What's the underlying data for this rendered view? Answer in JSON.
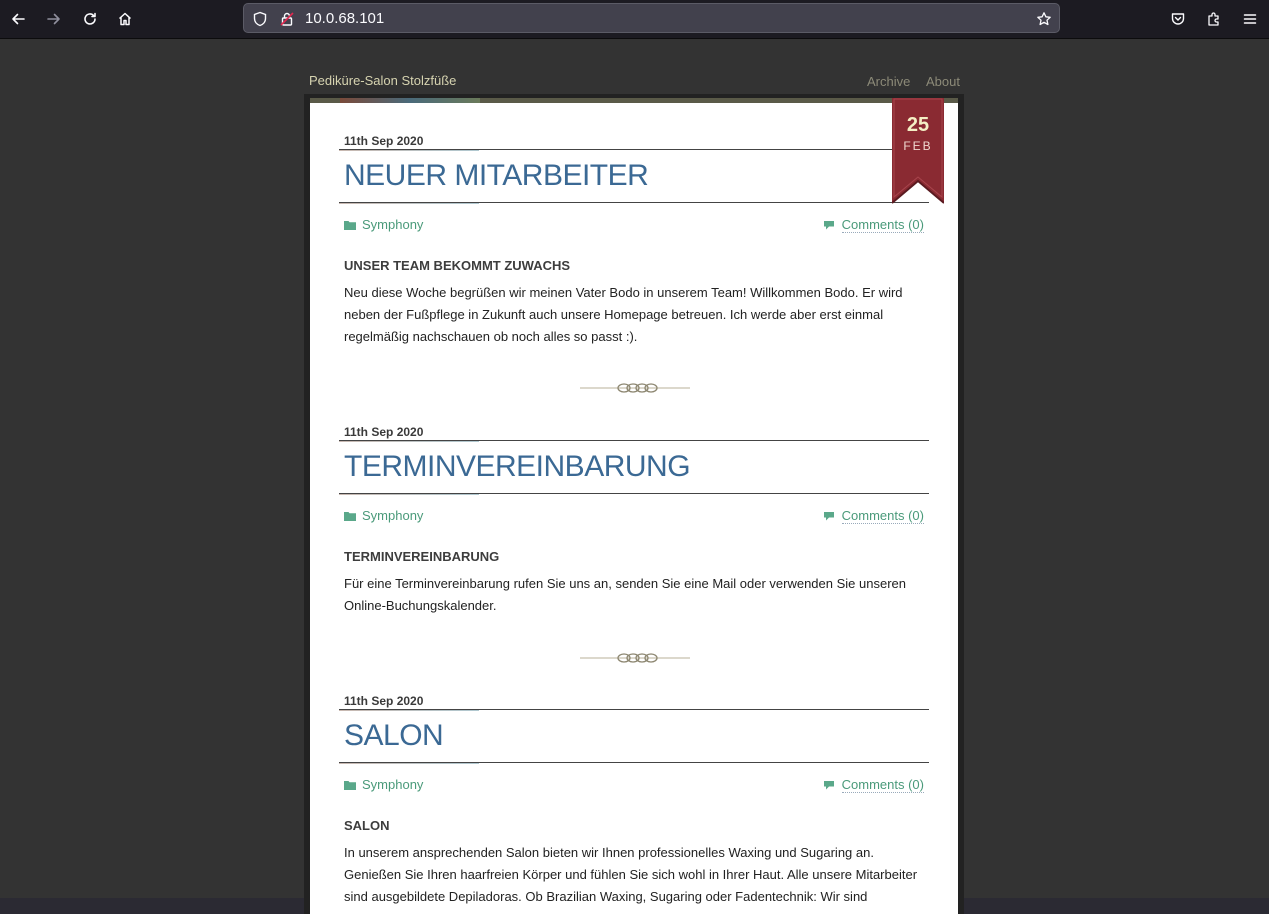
{
  "browser": {
    "url": "10.0.68.101"
  },
  "site": {
    "title": "Pediküre-Salon Stolzfüße",
    "nav": [
      "Archive",
      "About"
    ]
  },
  "ribbon": {
    "day": "25",
    "month": "FEB"
  },
  "posts": [
    {
      "date": "11th Sep 2020",
      "title": "NEUER MITARBEITER",
      "category": "Symphony",
      "comments": "Comments (0)",
      "subhead": "UNSER TEAM BEKOMMT ZUWACHS",
      "body": "Neu diese Woche begrüßen wir meinen Vater Bodo in unserem Team! Willkommen Bodo. Er wird neben der Fußpflege in Zukunft auch unsere Homepage betreuen. Ich werde aber erst einmal regelmäßig nachschauen ob noch alles so passt :)."
    },
    {
      "date": "11th Sep 2020",
      "title": "TERMINVEREINBARUNG",
      "category": "Symphony",
      "comments": "Comments (0)",
      "subhead": "TERMINVEREINBARUNG",
      "body": "Für eine Terminvereinbarung rufen Sie uns an, senden Sie eine Mail oder verwenden Sie unseren Online-Buchungskalender."
    },
    {
      "date": "11th Sep 2020",
      "title": "SALON",
      "category": "Symphony",
      "comments": "Comments (0)",
      "subhead": "SALON",
      "body": "In unserem ansprechenden Salon bieten wir Ihnen professionelles Waxing und Sugaring an. Genießen Sie Ihren haarfreien Körper und fühlen Sie sich wohl in Ihrer Haut. Alle unsere Mitarbeiter sind ausgebildete Depiladoras. Ob Brazilian Waxing, Sugaring oder Fadentechnik: Wir sind"
    }
  ]
}
